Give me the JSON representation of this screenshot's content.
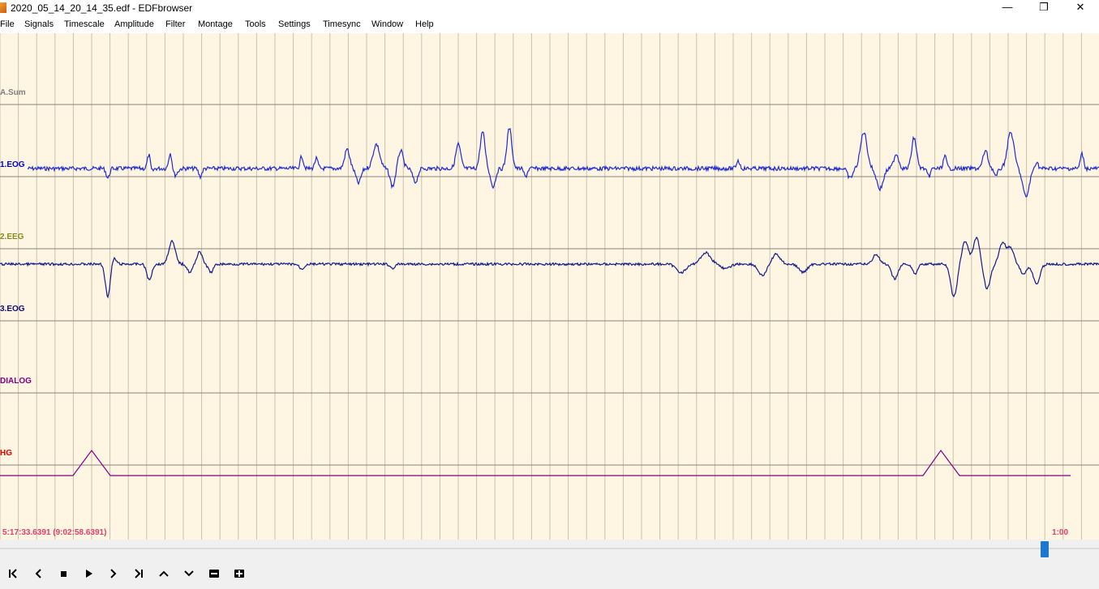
{
  "window": {
    "title": "2020_05_14_20_14_35.edf - EDFbrowser",
    "minimize_icon": "minimize-icon",
    "restore_icon": "restore-icon",
    "close_icon": "close-icon"
  },
  "menu": {
    "items": [
      "File",
      "Signals",
      "Timescale",
      "Amplitude",
      "Filter",
      "Montage",
      "Tools",
      "Settings",
      "Timesync",
      "Window",
      "Help"
    ]
  },
  "signals": [
    {
      "label": "A.Sum",
      "color": "#808080"
    },
    {
      "label": "1.EOG",
      "color": "#0000cc"
    },
    {
      "label": "2.EEG",
      "color": "#8a8a1c"
    },
    {
      "label": "3.EOG",
      "color": "#0c0c7a"
    },
    {
      "label": "DIALOG",
      "color": "#800080"
    },
    {
      "label": "HG",
      "color": "#e00000"
    }
  ],
  "colors": {
    "background": "#fff5e3",
    "grid": "#c9c2a8",
    "baseline": "#8a8478",
    "trace_eog1": "#1f2ad6",
    "trace_eog3": "#121a8c",
    "trace_hg": "#800080",
    "time_text": "#e0406a",
    "scroll_handle": "#1a78d4"
  },
  "timeline": {
    "start": "5:17:33.6391 (9:02:58.6391)",
    "window_length": "1:00"
  },
  "toolbar": {
    "buttons": [
      {
        "name": "first-page-button",
        "icon": "skip-start-icon"
      },
      {
        "name": "previous-button",
        "icon": "chevron-left-icon"
      },
      {
        "name": "stop-button",
        "icon": "stop-icon"
      },
      {
        "name": "play-button",
        "icon": "play-icon"
      },
      {
        "name": "next-button",
        "icon": "chevron-right-icon"
      },
      {
        "name": "last-page-button",
        "icon": "skip-end-icon"
      },
      {
        "name": "scroll-up-button",
        "icon": "chevron-up-icon"
      },
      {
        "name": "scroll-down-button",
        "icon": "chevron-down-icon"
      },
      {
        "name": "zoom-out-button",
        "icon": "minus-icon"
      },
      {
        "name": "zoom-in-button",
        "icon": "plus-icon"
      }
    ]
  }
}
